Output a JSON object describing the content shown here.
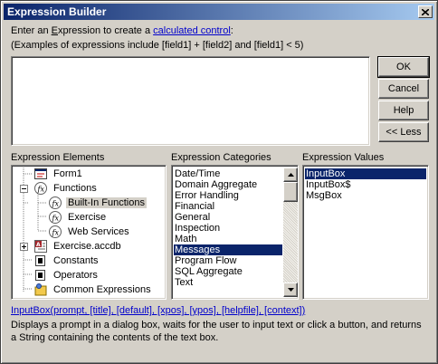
{
  "window": {
    "title": "Expression Builder"
  },
  "intro": {
    "pre": "Enter an ",
    "underlined": "E",
    "mid": "xpression to create a ",
    "link": "calculated control",
    "post": ":"
  },
  "example_text": "(Examples of expressions include [field1] + [field2] and [field1] < 5)",
  "expression_input": {
    "value": ""
  },
  "buttons": {
    "ok": "OK",
    "cancel": "Cancel",
    "help": "Help",
    "less": "<< Less"
  },
  "elements": {
    "label": "Expression Elements",
    "items": [
      {
        "label": "Form1",
        "icon": "form-icon",
        "expander": "none",
        "depth": 1
      },
      {
        "label": "Functions",
        "icon": "function-icon",
        "expander": "minus",
        "depth": 0
      },
      {
        "label": "Built-In Functions",
        "icon": "function-icon",
        "expander": "none",
        "depth": 1,
        "selected": true
      },
      {
        "label": "Exercise",
        "icon": "function-icon",
        "expander": "none",
        "depth": 1
      },
      {
        "label": "Web Services",
        "icon": "function-icon",
        "expander": "none",
        "depth": 1
      },
      {
        "label": "Exercise.accdb",
        "icon": "database-icon",
        "expander": "plus",
        "depth": 0
      },
      {
        "label": "Constants",
        "icon": "constants-folder-icon",
        "expander": "none",
        "depth": 0
      },
      {
        "label": "Operators",
        "icon": "operators-folder-icon",
        "expander": "none",
        "depth": 0
      },
      {
        "label": "Common Expressions",
        "icon": "common-expressions-icon",
        "expander": "none",
        "depth": 0
      }
    ]
  },
  "categories": {
    "label": "Expression Categories",
    "items": [
      "Date/Time",
      "Domain Aggregate",
      "Error Handling",
      "Financial",
      "General",
      "Inspection",
      "Math",
      "Messages",
      "Program Flow",
      "SQL Aggregate",
      "Text"
    ],
    "selected_index": 7
  },
  "values": {
    "label": "Expression Values",
    "items": [
      "InputBox",
      "InputBox$",
      "MsgBox"
    ],
    "selected_index": 0
  },
  "syntax": "InputBox(prompt, [title], [default], [xpos], [ypos], [helpfile], [context])",
  "description": {
    "line1": "Displays a prompt in a dialog box, waits for the user to input text or click a button, and returns",
    "line2": "a String containing the contents of the text box."
  },
  "colors": {
    "selection": "#0a246a",
    "link": "#0000cc",
    "dialog": "#d4d0c8"
  }
}
